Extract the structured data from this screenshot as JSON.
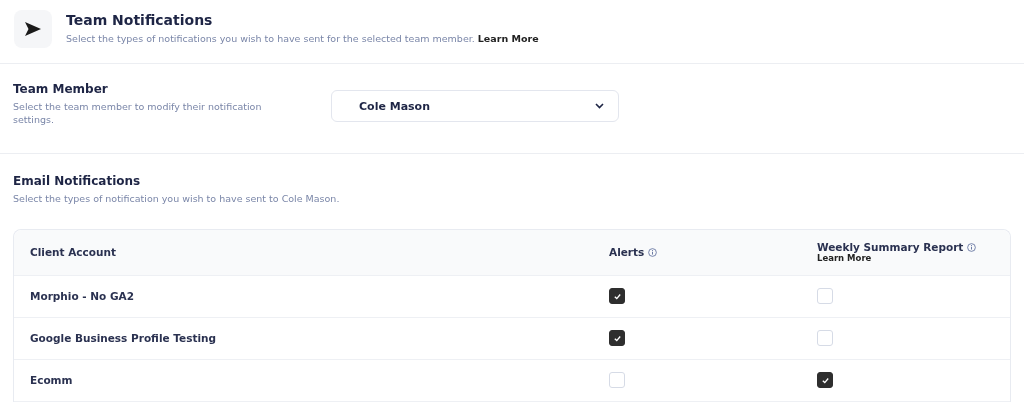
{
  "header": {
    "title": "Team Notifications",
    "description": "Select the types of notifications you wish to have sent for the selected team member.",
    "link": "Learn More"
  },
  "team_member": {
    "title": "Team Member",
    "description": "Select the team member to modify their notification settings.",
    "value": "Cole Mason"
  },
  "email_notifications": {
    "title": "Email Notifications",
    "description": "Select the types of notification you wish to have sent to Cole Mason.",
    "table": {
      "columns": [
        {
          "label": "Client Account"
        },
        {
          "label": "Alerts",
          "info": true
        },
        {
          "label": "Weekly Summary Report",
          "info": true,
          "link": "Learn More"
        }
      ],
      "rows": [
        {
          "name": "Morphio - No GA2",
          "alerts": true,
          "weekly": false
        },
        {
          "name": "Google Business Profile Testing",
          "alerts": true,
          "weekly": false
        },
        {
          "name": "Ecomm",
          "alerts": false,
          "weekly": true
        }
      ]
    }
  }
}
